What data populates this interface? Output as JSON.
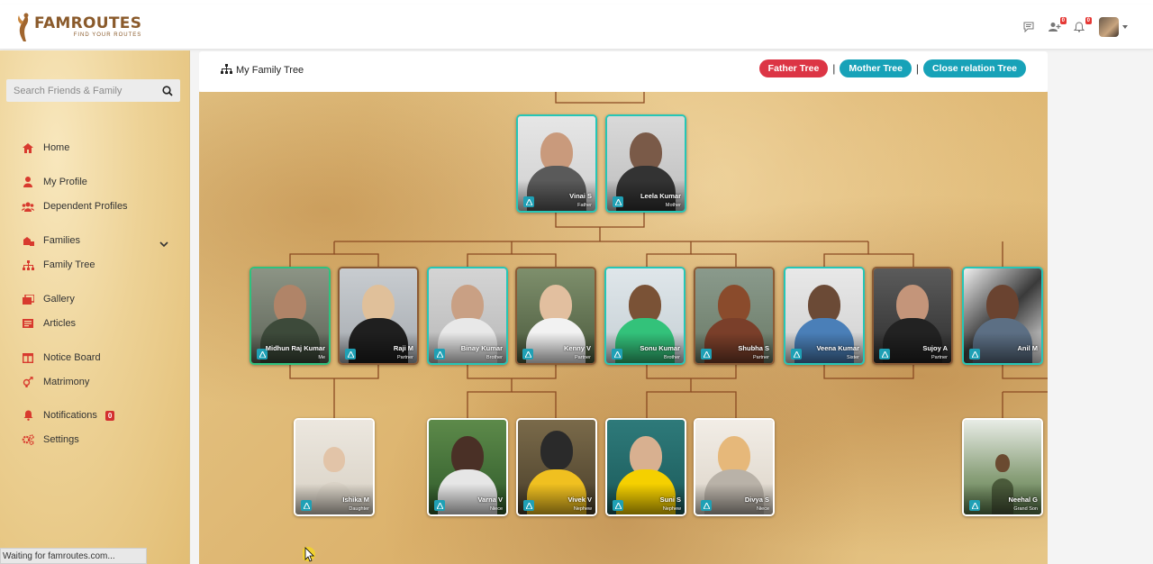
{
  "brand": {
    "name": "FAMROUTES",
    "tagline": "FIND YOUR ROUTES",
    "color": "#8a5a2b"
  },
  "header_icons": [
    {
      "icon": "chat-icon"
    },
    {
      "icon": "friend-requests-icon",
      "badge": "0"
    },
    {
      "icon": "bell-icon",
      "badge": "0"
    },
    {
      "icon": "user-avatar"
    }
  ],
  "search": {
    "placeholder": "Search Friends & Family"
  },
  "nav": [
    {
      "label": "Home",
      "icon": "home-icon"
    },
    {
      "label": "My Profile",
      "icon": "user-icon"
    },
    {
      "label": "Dependent Profiles",
      "icon": "users-icon"
    },
    {
      "label": "Families",
      "icon": "families-icon"
    },
    {
      "label": "Family Tree",
      "icon": "sitemap-icon"
    },
    {
      "label": "Gallery",
      "icon": "gallery-icon"
    },
    {
      "label": "Articles",
      "icon": "articles-icon"
    },
    {
      "label": "Notice Board",
      "icon": "notice-board-icon"
    },
    {
      "label": "Matrimony",
      "icon": "matrimony-icon"
    },
    {
      "label": "Notifications",
      "icon": "bell-icon",
      "badge": "0"
    },
    {
      "label": "Settings",
      "icon": "gears-icon"
    }
  ],
  "page": {
    "title": "My Family Tree",
    "buttons": [
      {
        "label": "Father Tree",
        "color": "#dc3545"
      },
      {
        "label": "Mother Tree",
        "color": "#17a2b8"
      },
      {
        "label": "Close relation Tree",
        "color": "#17a2b8"
      }
    ]
  },
  "tree": {
    "parents": [
      {
        "name": "Vinai S",
        "relation": "Father"
      },
      {
        "name": "Leela Kumar",
        "relation": "Mother"
      }
    ],
    "generation": [
      {
        "name": "Midhun Raj Kumar",
        "relation": "Me"
      },
      {
        "name": "Raji M",
        "relation": "Partner"
      },
      {
        "name": "Binay Kumar",
        "relation": "Brother"
      },
      {
        "name": "Kenny V",
        "relation": "Partner"
      },
      {
        "name": "Sonu Kumar",
        "relation": "Brother"
      },
      {
        "name": "Shubha S",
        "relation": "Partner"
      },
      {
        "name": "Veena Kumar",
        "relation": "Sister"
      },
      {
        "name": "Sujoy A",
        "relation": "Partner"
      },
      {
        "name": "Anil M",
        "relation": ""
      }
    ],
    "children": [
      {
        "name": "Ishika M",
        "relation": "Daughter"
      },
      {
        "name": "Varna V",
        "relation": "Niece"
      },
      {
        "name": "Vivek V",
        "relation": "Nephew"
      },
      {
        "name": "Suni S",
        "relation": "Nephew"
      },
      {
        "name": "Divya S",
        "relation": "Niece"
      },
      {
        "name": "Neehal G",
        "relation": "Grand Son"
      }
    ]
  },
  "status_bar": "Waiting for famroutes.com..."
}
